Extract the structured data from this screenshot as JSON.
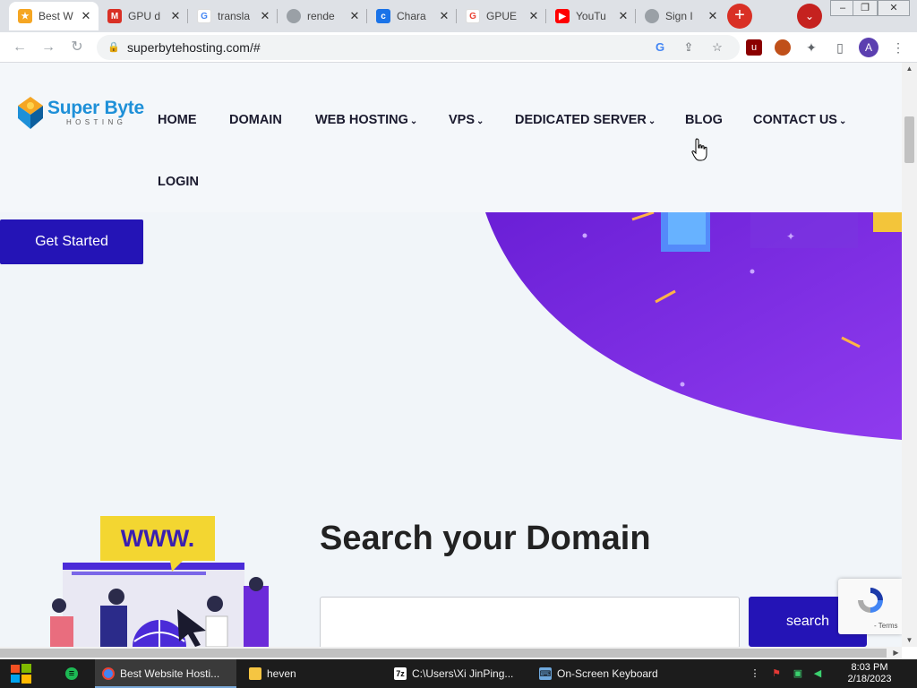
{
  "browser": {
    "tabs": [
      {
        "title": "Best W",
        "active": true,
        "icon_color": "#f5a623"
      },
      {
        "title": "GPU d",
        "active": false,
        "icon_color": "#d93025"
      },
      {
        "title": "transla",
        "active": false,
        "icon_color": "#4285f4"
      },
      {
        "title": "rende",
        "active": false,
        "icon_color": "#9aa0a6"
      },
      {
        "title": "Chara",
        "active": false,
        "icon_color": "#1a73e8"
      },
      {
        "title": "GPUE",
        "active": false,
        "icon_color": "#ea4335"
      },
      {
        "title": "YouTu",
        "active": false,
        "icon_color": "#ff0000"
      },
      {
        "title": "Sign I",
        "active": false,
        "icon_color": "#9aa0a6"
      }
    ],
    "new_tab_symbol": "+",
    "url": "superbytehosting.com/#",
    "profile_initial": "A"
  },
  "site": {
    "logo": {
      "name": "Super Byte",
      "tagline": "HOSTING"
    },
    "nav": {
      "home": "HOME",
      "domain": "DOMAIN",
      "web_hosting": "WEB HOSTING",
      "vps": "VPS",
      "dedicated_server": "DEDICATED SERVER",
      "blog": "BLOG",
      "contact_us": "CONTACT US",
      "login": "LOGIN"
    },
    "hero": {
      "cta": "Get Started"
    },
    "domain_search": {
      "title": "Search your Domain",
      "input_value": "",
      "button": "search",
      "illustration_text": "WWW."
    },
    "recaptcha": {
      "links": "- Terms"
    },
    "colors": {
      "primary": "#2414b6",
      "accent": "#1e90d8",
      "hero_purple": "#7b2ee6"
    }
  },
  "taskbar": {
    "items": [
      {
        "label": "Best Website Hosti...",
        "icon": "chrome-icon"
      },
      {
        "label": "heven",
        "icon": "folder-icon"
      },
      {
        "label": "C:\\Users\\Xi JinPing...",
        "icon": "7zip-icon"
      },
      {
        "label": "On-Screen Keyboard",
        "icon": "keyboard-icon"
      }
    ],
    "clock": {
      "time": "8:03 PM",
      "date": "2/18/2023"
    }
  }
}
